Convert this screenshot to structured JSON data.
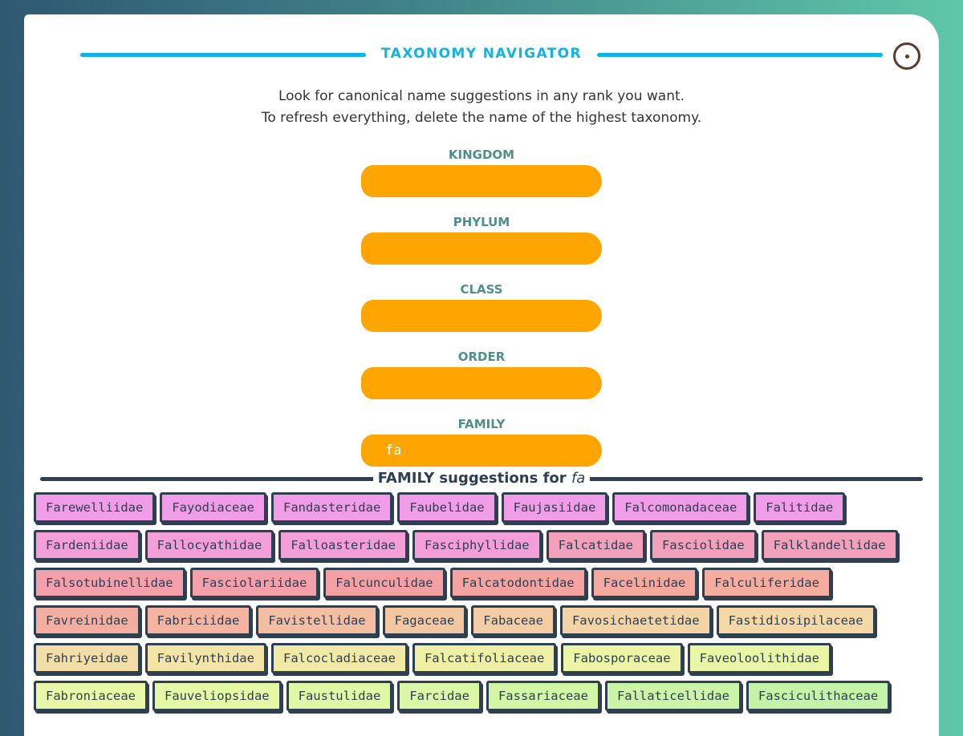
{
  "header": {
    "title": "TAXONOMY NAVIGATOR",
    "close_icon": "close-circle-icon"
  },
  "intro": {
    "line1": "Look for canonical name suggestions in any rank you want.",
    "line2": "To refresh everything, delete the name of the highest taxonomy."
  },
  "ranks": [
    {
      "label": "KINGDOM",
      "value": ""
    },
    {
      "label": "PHYLUM",
      "value": ""
    },
    {
      "label": "CLASS",
      "value": ""
    },
    {
      "label": "ORDER",
      "value": ""
    },
    {
      "label": "FAMILY",
      "value": "fa"
    }
  ],
  "suggestions": {
    "title_prefix": "FAMILY suggestions for",
    "query": "fa",
    "items": [
      {
        "name": "Farewelliidae",
        "color": "#f09ce6"
      },
      {
        "name": "Fayodiaceae",
        "color": "#f09ce6"
      },
      {
        "name": "Fandasteridae",
        "color": "#f09ce6"
      },
      {
        "name": "Faubelidae",
        "color": "#f09ce6"
      },
      {
        "name": "Faujasiidae",
        "color": "#f09ce6"
      },
      {
        "name": "Falcomonadaceae",
        "color": "#f09ce6"
      },
      {
        "name": "Falitidae",
        "color": "#f09ce6"
      },
      {
        "name": "Fardeniidae",
        "color": "#f39ed6"
      },
      {
        "name": "Fallocyathidae",
        "color": "#f39ed6"
      },
      {
        "name": "Falloasteridae",
        "color": "#f39ed6"
      },
      {
        "name": "Fasciphyllidae",
        "color": "#f39ed6"
      },
      {
        "name": "Falcatidae",
        "color": "#f3a0ba"
      },
      {
        "name": "Fasciolidae",
        "color": "#f3a0ba"
      },
      {
        "name": "Falklandellidae",
        "color": "#f3a0ba"
      },
      {
        "name": "Falsotubinellidae",
        "color": "#f3a0ab"
      },
      {
        "name": "Fasciolariidae",
        "color": "#f3a0ab"
      },
      {
        "name": "Falcunculidae",
        "color": "#f3a0a4"
      },
      {
        "name": "Falcatodontidae",
        "color": "#f3a4a0"
      },
      {
        "name": "Facelinidae",
        "color": "#f4a99f"
      },
      {
        "name": "Falculiferidae",
        "color": "#f4ad9f"
      },
      {
        "name": "Favreinidae",
        "color": "#f4ae9f"
      },
      {
        "name": "Fabriciidae",
        "color": "#f4b4a0"
      },
      {
        "name": "Favistellidae",
        "color": "#f4bea2"
      },
      {
        "name": "Fagaceae",
        "color": "#f4c7a3"
      },
      {
        "name": "Fabaceae",
        "color": "#f4cda5"
      },
      {
        "name": "Favosichaetetidae",
        "color": "#f4d3a5"
      },
      {
        "name": "Fastidiosipilaceae",
        "color": "#f4d8a6"
      },
      {
        "name": "Fahriyeidae",
        "color": "#f4dea7"
      },
      {
        "name": "Favilynthidae",
        "color": "#f3e5a7"
      },
      {
        "name": "Falcocladiaceae",
        "color": "#f1eaa6"
      },
      {
        "name": "Falcatifoliaceae",
        "color": "#eff0a6"
      },
      {
        "name": "Fabosporaceae",
        "color": "#ecf4a6"
      },
      {
        "name": "Faveoloolithidae",
        "color": "#e8f6a6"
      },
      {
        "name": "Fabroniaceae",
        "color": "#e9f8a6"
      },
      {
        "name": "Fauveliopsidae",
        "color": "#e5f8a6"
      },
      {
        "name": "Faustulidae",
        "color": "#dff8a6"
      },
      {
        "name": "Farcidae",
        "color": "#d9f7a6"
      },
      {
        "name": "Fassariaceae",
        "color": "#d2f6a6"
      },
      {
        "name": "Fallaticellidae",
        "color": "#caf4a6"
      },
      {
        "name": "Fasciculithaceae",
        "color": "#c4f2a6"
      }
    ]
  }
}
